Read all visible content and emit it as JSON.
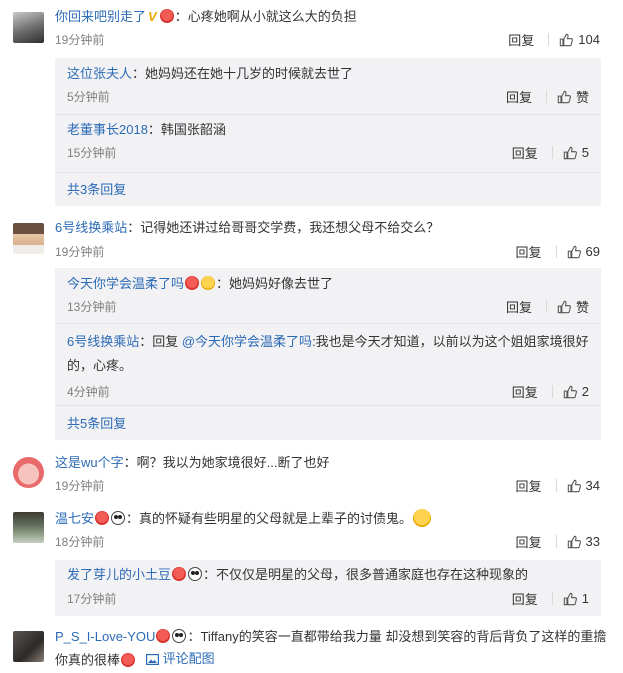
{
  "c1": {
    "username": "你回来吧别走了",
    "text": "：心疼她啊从小就这么大的负担",
    "time": "19分钟前",
    "reply": "回复",
    "likes": "104",
    "replies": [
      {
        "username": "这位张夫人",
        "text": "：她妈妈还在她十几岁的时候就去世了",
        "time": "5分钟前",
        "reply": "回复",
        "likes": "赞"
      },
      {
        "username": "老董事长2018",
        "text": "：韩国张韶涵",
        "time": "15分钟前",
        "reply": "回复",
        "likes": "5"
      }
    ],
    "more": "共3条回复"
  },
  "c2": {
    "username": "6号线换乘站",
    "text": "：记得她还讲过给哥哥交学费，我还想父母不给交么？",
    "time": "19分钟前",
    "reply": "回复",
    "likes": "69",
    "replies": [
      {
        "username": "今天你学会温柔了吗",
        "text": "：她妈妈好像去世了",
        "time": "13分钟前",
        "reply": "回复",
        "likes": "赞"
      },
      {
        "username": "6号线换乘站",
        "text_a": "：回复 ",
        "mention": "@今天你学会温柔了吗",
        "text_b": ":我也是今天才知道，以前以为这个姐姐家境很好",
        "text_c": "的，心疼。",
        "time": "4分钟前",
        "reply": "回复",
        "likes": "2"
      }
    ],
    "more": "共5条回复"
  },
  "c3": {
    "username": "这是wu个字",
    "text": "：啊？我以为她家境很好...断了也好",
    "time": "19分钟前",
    "reply": "回复",
    "likes": "34"
  },
  "c4": {
    "username": "温七安",
    "text": "：真的怀疑有些明星的父母就是上辈子的讨债鬼。",
    "time": "18分钟前",
    "reply": "回复",
    "likes": "33",
    "replies": [
      {
        "username": "发了芽儿的小土豆",
        "text": "：不仅仅是明星的父母，很多普通家庭也存在这种现象的",
        "time": "17分钟前",
        "reply": "回复",
        "likes": "1"
      }
    ]
  },
  "c5": {
    "username": "P_S_I-Love-YOU",
    "text": "：Tiffany的笑容一直都带给我力量 却没想到笑容的背后背负了这样的重擔",
    "text2": "你真的很棒",
    "pic_label": "评论配图"
  },
  "badges": {
    "v": "V"
  },
  "colors": {
    "link": "#2b6bb5",
    "sub_bg": "#f2f2f5",
    "time": "#808080"
  },
  "icons": [
    "thumb-up-icon",
    "picture-icon",
    "heart-face-emoji",
    "panda-emoji",
    "smile-emoji"
  ]
}
